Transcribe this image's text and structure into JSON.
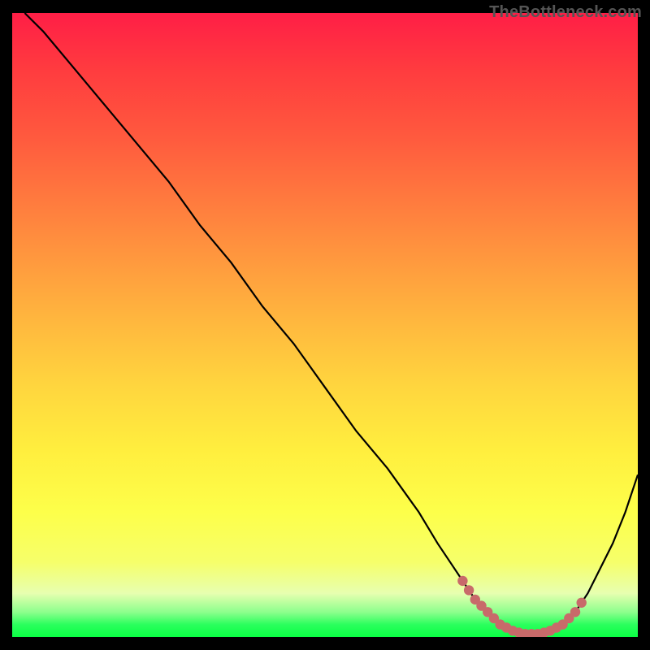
{
  "watermark": "TheBottleneck.com",
  "chart_data": {
    "type": "line",
    "title": "",
    "xlabel": "",
    "ylabel": "",
    "xlim": [
      0,
      100
    ],
    "ylim": [
      0,
      100
    ],
    "grid": false,
    "series": [
      {
        "name": "bottleneck-curve",
        "color": "#000000",
        "x": [
          2,
          5,
          10,
          15,
          20,
          25,
          30,
          35,
          40,
          45,
          50,
          55,
          60,
          65,
          68,
          70,
          72,
          74,
          76,
          78,
          80,
          82,
          84,
          86,
          88,
          90,
          92,
          94,
          96,
          98,
          100
        ],
        "values": [
          100,
          97,
          91,
          85,
          79,
          73,
          66,
          60,
          53,
          47,
          40,
          33,
          27,
          20,
          15,
          12,
          9,
          6,
          4,
          2,
          1,
          0.5,
          0.5,
          1,
          2,
          4,
          7,
          11,
          15,
          20,
          26
        ]
      }
    ],
    "highlight": {
      "name": "minimum-region",
      "color": "#c86a6a",
      "x": [
        72,
        73,
        74,
        75,
        76,
        77,
        78,
        79,
        80,
        81,
        82,
        83,
        84,
        85,
        86,
        87,
        88,
        89,
        90,
        91
      ],
      "values": [
        9,
        7.5,
        6,
        5,
        4,
        3,
        2,
        1.5,
        1,
        0.7,
        0.5,
        0.5,
        0.5,
        0.7,
        1,
        1.5,
        2,
        3,
        4,
        5.5
      ]
    },
    "background_gradient": {
      "top_color": "#ff1e46",
      "mid_color": "#ffee3e",
      "bottom_color": "#0aff44",
      "meaning": "red=high bottleneck, green=low bottleneck"
    }
  }
}
